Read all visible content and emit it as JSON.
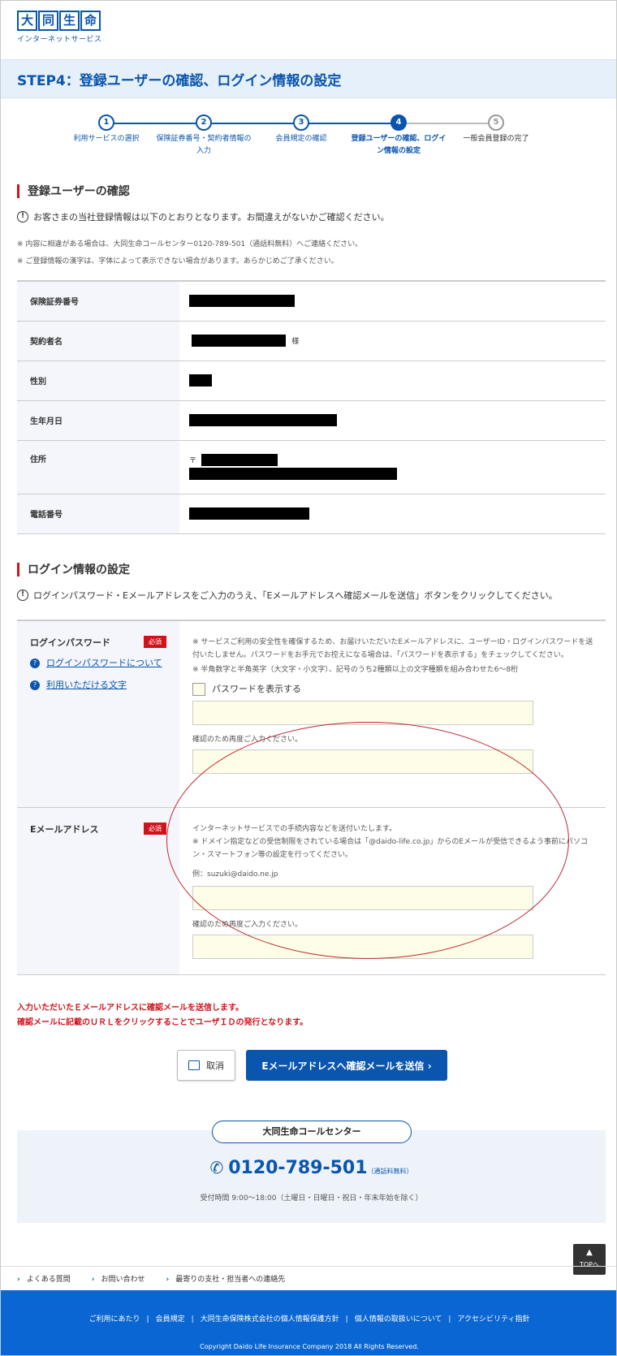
{
  "header": {
    "logo_chars": [
      "大",
      "同",
      "生",
      "命"
    ],
    "logo_sub": "インターネットサービス"
  },
  "page_title": "STEP4：登録ユーザーの確認、ログイン情報の設定",
  "steps": [
    {
      "num": "1",
      "label": "利用サービスの選択"
    },
    {
      "num": "2",
      "label": "保険証券番号・契約者情報の入力"
    },
    {
      "num": "3",
      "label": "会員規定の確認"
    },
    {
      "num": "4",
      "label": "登録ユーザーの確認、ログイン情報の設定"
    },
    {
      "num": "5",
      "label": "一般会員登録の完了"
    }
  ],
  "user_section": {
    "heading": "登録ユーザーの確認",
    "notice": "お客さまの当社登録情報は以下のとおりとなります。お間違えがないかご確認ください。",
    "note1": "※ 内容に相違がある場合は、大同生命コールセンター0120-789-501（通話料無料）へご連絡ください。",
    "note2": "※ ご登録情報の漢字は、字体によって表示できない場合があります。あらかじめご了承ください。",
    "rows": [
      {
        "label": "保険証券番号"
      },
      {
        "label": "契約者名",
        "suffix": "様"
      },
      {
        "label": "性別"
      },
      {
        "label": "生年月日"
      },
      {
        "label": "住所",
        "prefix": "〒"
      },
      {
        "label": "電話番号"
      }
    ]
  },
  "login_section": {
    "heading": "ログイン情報の設定",
    "notice": "ログインパスワード・Eメールアドレスをご入力のうえ、「Eメールアドレスへ確認メールを送信」ボタンをクリックしてください。",
    "password": {
      "label": "ログインパスワード",
      "required": "必須",
      "help1": "ログインパスワードについて",
      "help2": "利用いただける文字",
      "desc1": "※ サービスご利用の安全性を確保するため、お届けいただいたEメールアドレスに、ユーザーID・ログインパスワードを送付いたしません。パスワードをお手元でお控えになる場合は、「パスワードを表示する」をチェックしてください。",
      "desc2": "※ 半角数字と半角英字（大文字・小文字）、記号のうち2種類以上の文字種類を組み合わせた6～8桁",
      "show_password": "パスワードを表示する",
      "confirm_label": "確認のため再度ご入力ください。"
    },
    "email": {
      "label": "Eメールアドレス",
      "required": "必須",
      "desc1": "インターネットサービスでの手続内容などを送付いたします。",
      "desc2": "※ ドメイン指定などの受信制限をされている場合は「@daido-life.co.jp」からのEメールが受信できるよう事前にパソコン・スマートフォン等の設定を行ってください。",
      "example": "例：suzuki@daido.ne.jp",
      "confirm_label": "確認のため再度ご入力ください。"
    }
  },
  "red_message": {
    "line1": "入力いただいたＥメールアドレスに確認メールを送信します。",
    "line2": "確認メールに記載のＵＲＬをクリックすることでユーザＩＤの発行となります。"
  },
  "buttons": {
    "cancel": "取消",
    "send": "Eメールアドレスへ確認メールを送信 ›"
  },
  "call_center": {
    "title": "大同生命コールセンター",
    "number": "0120-789-501",
    "free": "（通話料無料）",
    "hours": "受付時間 9:00～18:00（土曜日・日曜日・祝日・年末年始を除く）"
  },
  "top_button": "TOPへ",
  "subnav": [
    "よくある質問",
    "お問い合わせ",
    "最寄りの支社・担当者への連絡先"
  ],
  "footer": {
    "links": [
      "ご利用にあたり",
      "会員規定",
      "大同生命保険株式会社の個人情報保護方針",
      "個人情報の取扱いについて",
      "アクセシビリティ指針"
    ],
    "copyright": "Copyright Daido Life Insurance Company 2018 All Rights Reserved."
  },
  "colors": {
    "brand": "#0a55ad",
    "alert": "#d0121b",
    "input_bg": "#fdfde8"
  }
}
